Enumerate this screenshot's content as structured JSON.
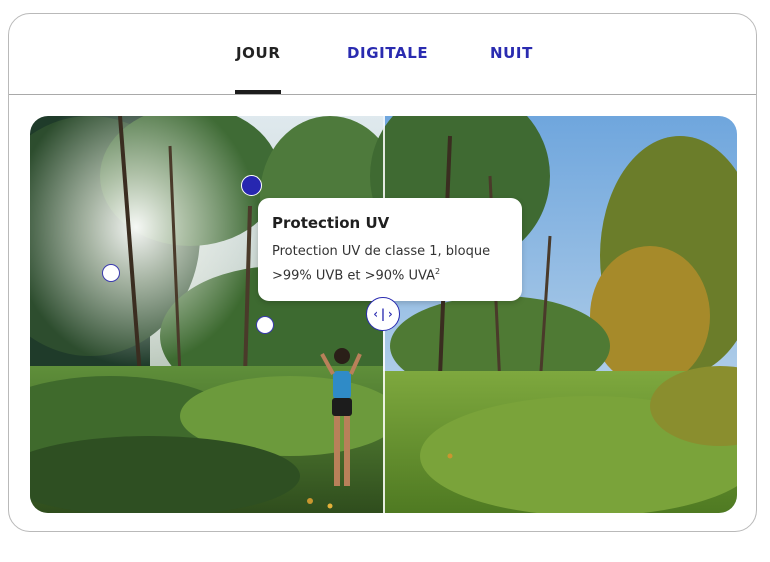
{
  "tabs": [
    {
      "label": "JOUR",
      "active": true
    },
    {
      "label": "DIGITALE",
      "active": false
    },
    {
      "label": "NUIT",
      "active": false
    }
  ],
  "tooltip": {
    "title": "Protection UV",
    "body_line1": "Protection UV de classe 1, bloque",
    "body_line2": ">99% UVB et >90% UVA",
    "footnote": "2"
  },
  "slider_handle": {
    "icon": "compare-arrows-icon",
    "glyph": "‹|›"
  },
  "colors": {
    "accent": "#2a2bb0",
    "active_tab": "#222222"
  }
}
